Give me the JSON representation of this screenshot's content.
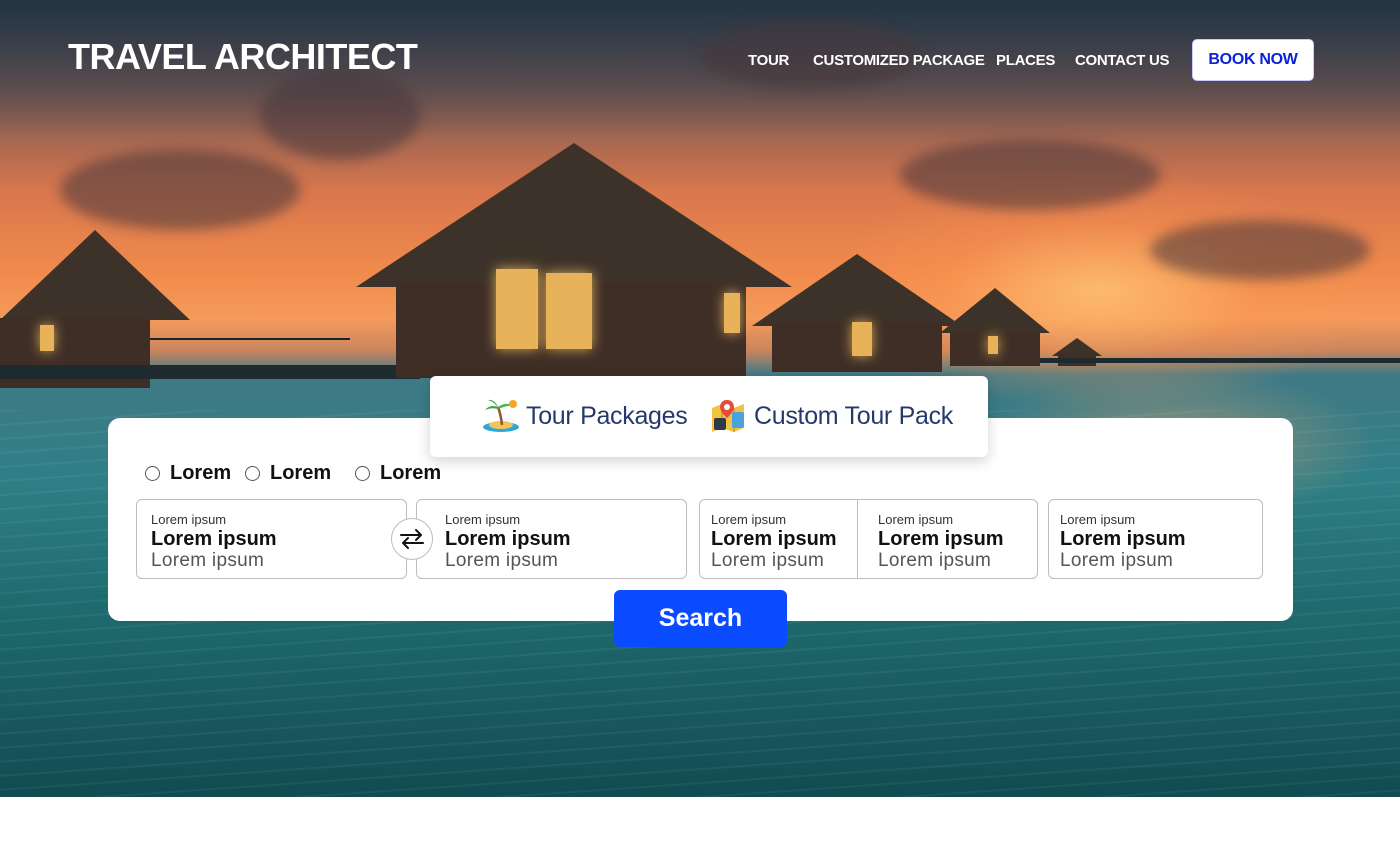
{
  "header": {
    "logo": "TRAVEL ARCHITECT",
    "nav": [
      "TOUR",
      "CUSTOMIZED PACKAGE",
      "PLACES",
      "CONTACT US"
    ],
    "book_now": "BOOK NOW"
  },
  "tabs": [
    {
      "label": "Tour Packages",
      "icon": "palm-island-icon"
    },
    {
      "label": "Custom Tour Pack",
      "icon": "map-pin-icon"
    }
  ],
  "radios": [
    "Lorem",
    "Lorem",
    "Lorem"
  ],
  "fields": [
    {
      "small": "Lorem ipsum",
      "main": "Lorem ipsum",
      "sub": "Lorem ipsum"
    },
    {
      "small": "Lorem ipsum",
      "main": "Lorem ipsum",
      "sub": "Lorem ipsum"
    },
    {
      "small": "Lorem ipsum",
      "main": "Lorem ipsum",
      "sub": "Lorem ipsum"
    },
    {
      "small": "Lorem ipsum",
      "main": "Lorem ipsum",
      "sub": "Lorem ipsum"
    },
    {
      "small": "Lorem ipsum",
      "main": "Lorem ipsum",
      "sub": "Lorem ipsum"
    }
  ],
  "search_label": "Search",
  "colors": {
    "accent": "#0b4bff",
    "book_text": "#0a22d6",
    "tab_text": "#243a6b"
  }
}
